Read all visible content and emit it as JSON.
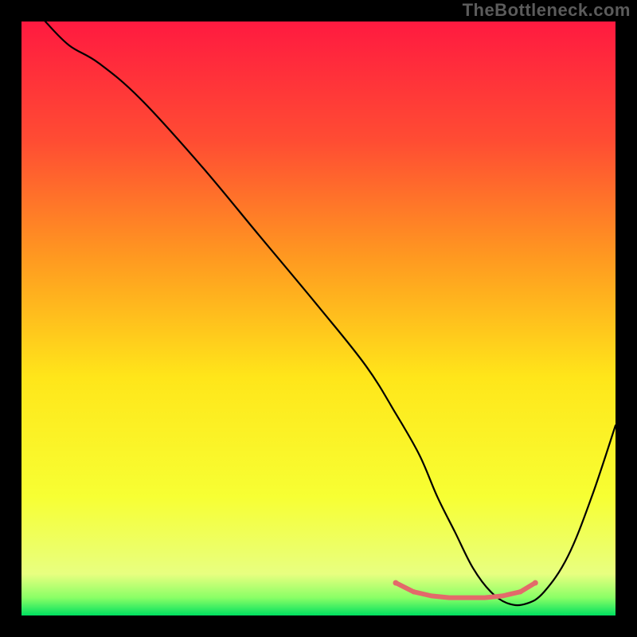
{
  "watermark": "TheBottleneck.com",
  "chart_data": {
    "type": "line",
    "title": "",
    "xlabel": "",
    "ylabel": "",
    "xlim": [
      0,
      100
    ],
    "ylim": [
      0,
      100
    ],
    "grid": false,
    "legend": false,
    "gradient_stops": [
      {
        "offset": 0.0,
        "color": "#ff1a40"
      },
      {
        "offset": 0.2,
        "color": "#ff4c33"
      },
      {
        "offset": 0.4,
        "color": "#ff9a20"
      },
      {
        "offset": 0.6,
        "color": "#ffe61a"
      },
      {
        "offset": 0.8,
        "color": "#f7ff33"
      },
      {
        "offset": 0.93,
        "color": "#e8ff80"
      },
      {
        "offset": 0.97,
        "color": "#8aff66"
      },
      {
        "offset": 1.0,
        "color": "#00e060"
      }
    ],
    "series": [
      {
        "name": "bottleneck-curve",
        "stroke": "#000000",
        "stroke_width": 2.2,
        "x": [
          4,
          8,
          13,
          20,
          30,
          40,
          50,
          58,
          63,
          67,
          70,
          73,
          76,
          79,
          82,
          85,
          88,
          92,
          96,
          100
        ],
        "values": [
          100,
          96,
          93,
          87,
          76,
          64,
          52,
          42,
          34,
          27,
          20,
          14,
          8,
          4,
          2,
          2,
          4,
          10,
          20,
          32
        ]
      },
      {
        "name": "bottleneck-marker-band",
        "stroke": "#e36a6a",
        "stroke_width": 6,
        "marker_radii": [
          3.5,
          3.2,
          2.5,
          2.0,
          2.0,
          2.0,
          2.5,
          3.2,
          3.5
        ],
        "x": [
          63,
          66,
          69,
          72,
          75,
          78,
          81,
          84,
          86.5
        ],
        "values": [
          5.5,
          4.0,
          3.3,
          3.0,
          3.0,
          3.0,
          3.3,
          4.0,
          5.5
        ]
      }
    ]
  }
}
